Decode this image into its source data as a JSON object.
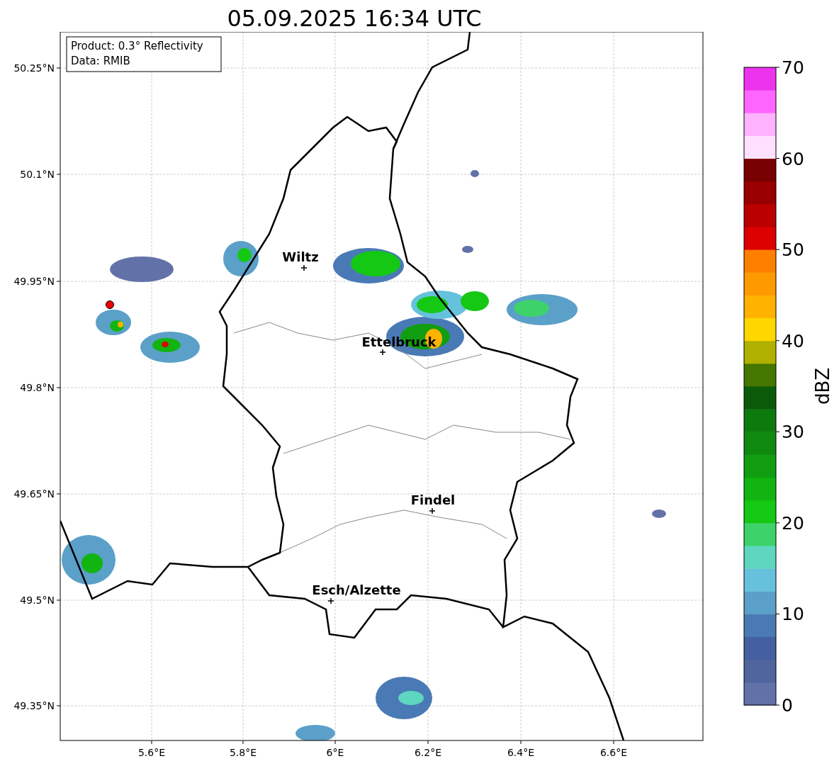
{
  "title": "05.09.2025 16:34 UTC",
  "info_box": {
    "lines": [
      "Product: 0.3° Reflectivity",
      "Data: RMIB"
    ]
  },
  "map": {
    "lat_ticks": [
      "50.25°N",
      "50.1°N",
      "49.95°N",
      "49.8°N",
      "49.65°N",
      "49.5°N",
      "49.35°N"
    ],
    "lon_ticks": [
      "5.6°E",
      "5.8°E",
      "6°E",
      "6.2°E",
      "6.4°E",
      "6.6°E"
    ],
    "cities": [
      {
        "name": "Wiltz"
      },
      {
        "name": "Ettelbruck"
      },
      {
        "name": "Findel"
      },
      {
        "name": "Esch/Alzette"
      }
    ]
  },
  "colorbar": {
    "label": "dBZ",
    "ticks": [
      "70",
      "60",
      "50",
      "40",
      "30",
      "20",
      "10",
      "0"
    ],
    "segments": [
      {
        "color": "#6272a8"
      },
      {
        "color": "#50649e"
      },
      {
        "color": "#4460a0"
      },
      {
        "color": "#4a7ab5"
      },
      {
        "color": "#5ba0c8"
      },
      {
        "color": "#66c2dc"
      },
      {
        "color": "#5fd6c0"
      },
      {
        "color": "#3dd36a"
      },
      {
        "color": "#14c814"
      },
      {
        "color": "#12b412"
      },
      {
        "color": "#109e10"
      },
      {
        "color": "#0f8a0f"
      },
      {
        "color": "#0d7a0d"
      },
      {
        "color": "#0a5a0a"
      },
      {
        "color": "#447700"
      },
      {
        "color": "#b0b000"
      },
      {
        "color": "#ffd700"
      },
      {
        "color": "#ffb300"
      },
      {
        "color": "#ff9900"
      },
      {
        "color": "#ff7f00"
      },
      {
        "color": "#dd0000"
      },
      {
        "color": "#bb0000"
      },
      {
        "color": "#990000"
      },
      {
        "color": "#770000"
      },
      {
        "color": "#ffe0ff"
      },
      {
        "color": "#ffb3ff"
      },
      {
        "color": "#ff66ff"
      },
      {
        "color": "#ee33ee"
      }
    ]
  }
}
